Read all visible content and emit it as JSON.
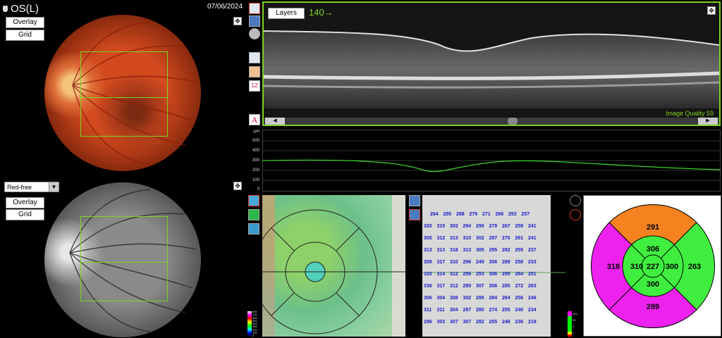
{
  "header": {
    "eye": "OS(L)",
    "date": "07/06/2024"
  },
  "top_fundus": {
    "overlay_label": "Overlay",
    "grid_label": "Grid"
  },
  "bottom_fundus": {
    "mode_value": "Red-free",
    "overlay_label": "Overlay",
    "grid_label": "Grid"
  },
  "bscan": {
    "layers_label": "Layers",
    "scan_number": "140→",
    "quality_label": "Image Quality 59"
  },
  "thickness_profile": {
    "unit": "µm",
    "ticks": [
      "500",
      "400",
      "300",
      "200",
      "100",
      "0"
    ]
  },
  "color_scale_left": {
    "ticks": [
      "800",
      "700",
      "600",
      "500",
      "400",
      "300",
      "200",
      "100",
      "0"
    ]
  },
  "color_scale_right": {
    "ticks": [
      "100",
      "95",
      "5",
      "1"
    ]
  },
  "thickness_grid": {
    "rows": [
      [
        "264",
        "285",
        "288",
        "279",
        "271",
        "266",
        "253",
        "257"
      ],
      [
        "320",
        "315",
        "302",
        "294",
        "290",
        "279",
        "267",
        "259",
        "241"
      ],
      [
        "305",
        "312",
        "313",
        "310",
        "302",
        "287",
        "276",
        "261",
        "241"
      ],
      [
        "313",
        "313",
        "318",
        "313",
        "305",
        "295",
        "282",
        "255",
        "237"
      ],
      [
        "309",
        "317",
        "310",
        "296",
        "249",
        "306",
        "289",
        "258",
        "233"
      ],
      [
        "320",
        "314",
        "312",
        "256",
        "253",
        "306",
        "295",
        "264",
        "251"
      ],
      [
        "336",
        "317",
        "312",
        "289",
        "307",
        "306",
        "285",
        "272",
        "263"
      ],
      [
        "306",
        "304",
        "308",
        "302",
        "295",
        "284",
        "264",
        "256",
        "246"
      ],
      [
        "311",
        "311",
        "304",
        "297",
        "280",
        "274",
        "255",
        "240",
        "234"
      ],
      [
        "296",
        "303",
        "307",
        "307",
        "282",
        "255",
        "246",
        "236",
        "219"
      ]
    ]
  },
  "etdrs": {
    "center": "227",
    "inner_superior": "306",
    "inner_temporal": "310",
    "inner_nasal": "300",
    "inner_inferior": "300",
    "outer_superior": "291",
    "outer_temporal": "318",
    "outer_nasal": "263",
    "outer_inferior": "289",
    "colors": {
      "orange": "#f5821f",
      "magenta": "#ee22ee",
      "green": "#40ee40"
    }
  }
}
